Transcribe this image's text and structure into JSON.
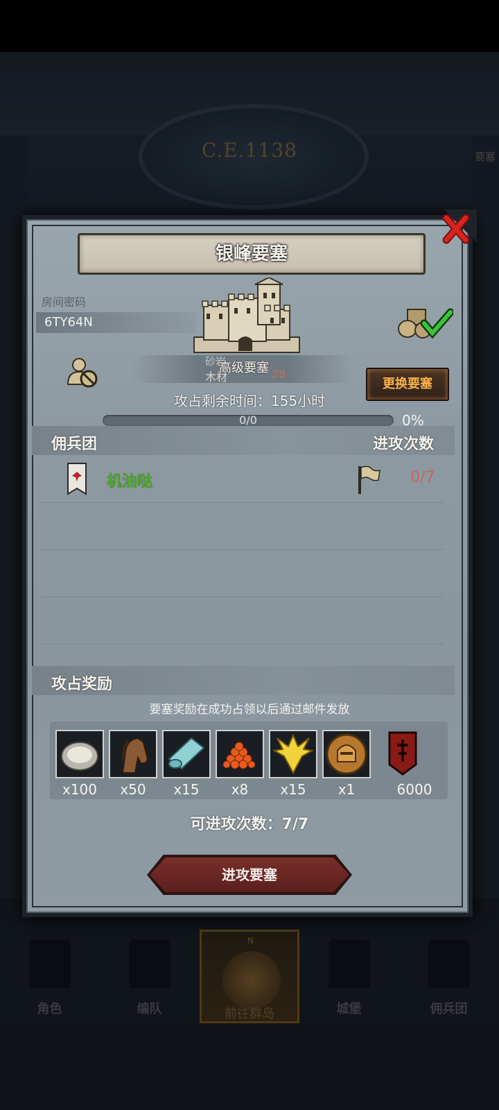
{
  "background": {
    "year_label": "C.E.1138",
    "side_label": "要塞"
  },
  "bottom_nav": {
    "compass_label": "N",
    "items": [
      {
        "label": "角色",
        "icon": "knight-icon"
      },
      {
        "label": "编队",
        "icon": "formation-icon"
      },
      {
        "label": "前往群岛",
        "icon": "map-compass-icon",
        "active": true
      },
      {
        "label": "城堡",
        "icon": "castle-icon"
      },
      {
        "label": "佣兵团",
        "icon": "mercenary-icon"
      }
    ]
  },
  "modal": {
    "title": "银峰要塞",
    "room_label": "房间密码",
    "room_code": "6TY64N",
    "castle_tier": "高级要塞",
    "castle_ghost_top": "砂岩",
    "castle_ghost_resource": "木材",
    "castle_ghost_value": "28",
    "change_button": "更换要塞",
    "time_left": "攻占剩余时间：155小时",
    "progress": {
      "text": "0/0",
      "percent_label": "0%",
      "value": 0
    },
    "mercenary_section": {
      "left": "佣兵团",
      "right": "进攻次数"
    },
    "mercenaries": [
      {
        "name": "机油哒",
        "attacks": "0/7"
      }
    ],
    "rewards_section": {
      "title": "攻占奖励"
    },
    "reward_note": "要塞奖励在成功占领以后通过邮件发放",
    "rewards": [
      {
        "icon": "oyster-icon",
        "qty": "x100"
      },
      {
        "icon": "horse-icon",
        "qty": "x50"
      },
      {
        "icon": "cloth-roll-icon",
        "qty": "x15"
      },
      {
        "icon": "caviar-icon",
        "qty": "x8"
      },
      {
        "icon": "golden-crest-icon",
        "qty": "x15"
      },
      {
        "icon": "helmet-medal-icon",
        "qty": "x1"
      },
      {
        "icon": "red-banner-icon",
        "qty": "6000"
      }
    ],
    "attack_count": "可进攻次数：7/7",
    "attack_button": "进攻要塞"
  },
  "colors": {
    "panel": "#8e9aa2",
    "accent_gold": "#f6b24a",
    "merc_name_green": "#4ea82a",
    "attack_red": "#c9655b",
    "button_red": "#7a2f2a"
  }
}
